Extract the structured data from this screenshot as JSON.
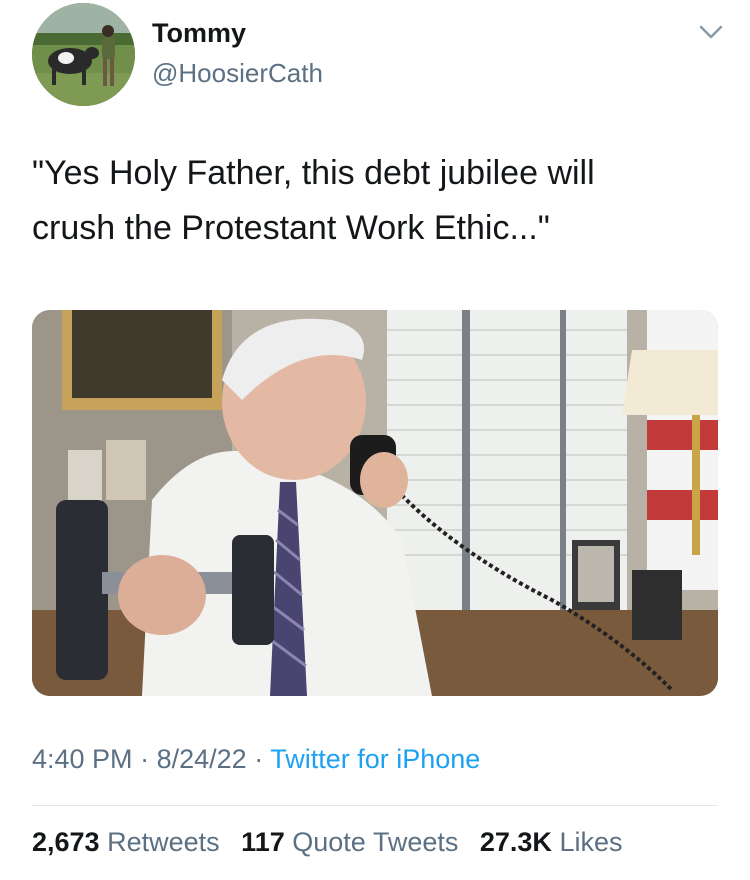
{
  "tweet": {
    "author": {
      "name": "Tommy",
      "handle": "@HoosierCath"
    },
    "text_lines": [
      "\"Yes Holy Father, this debt jubilee will",
      "crush the Protestant Work Ethic...\""
    ],
    "time": "4:40 PM",
    "separator": "·",
    "date": "8/24/22",
    "source": "Twitter for iPhone",
    "stats": {
      "retweets_count": "2,673",
      "retweets_label": "Retweets",
      "quotes_count": "117",
      "quotes_label": "Quote Tweets",
      "likes_count": "27.3K",
      "likes_label": "Likes"
    }
  },
  "colors": {
    "text": "#14171a",
    "secondary": "#5b7083",
    "link": "#1da1f2",
    "divider": "#e1e8ed"
  },
  "icons": {
    "menu": "chevron-down-icon"
  }
}
